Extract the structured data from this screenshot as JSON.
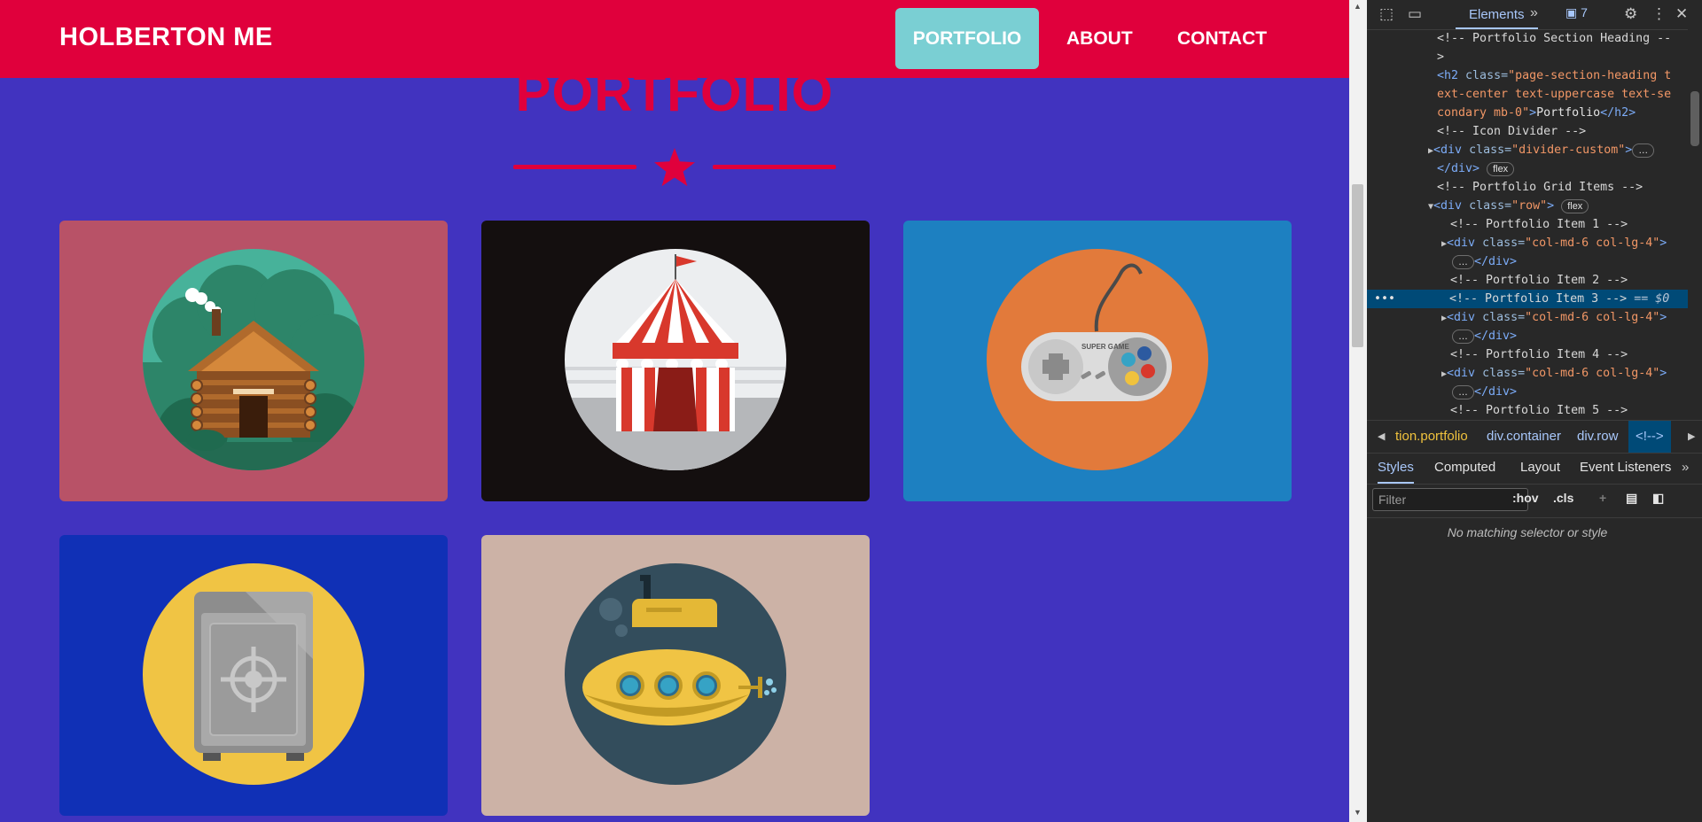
{
  "navbar": {
    "brand": "HOLBERTON ME",
    "links": [
      {
        "label": "PORTFOLIO",
        "active": true
      },
      {
        "label": "ABOUT",
        "active": false
      },
      {
        "label": "CONTACT",
        "active": false
      }
    ]
  },
  "portfolio": {
    "heading": "PORTFOLIO",
    "items": [
      {
        "icon": "log-cabin-icon",
        "bg": "#b85267"
      },
      {
        "icon": "circus-tent-icon",
        "bg": "#140f0f"
      },
      {
        "icon": "game-controller-icon",
        "bg": "#1d80c1",
        "controller_text": "SUPER GAME"
      },
      {
        "icon": "safe-icon",
        "bg": "#1030b6"
      },
      {
        "icon": "submarine-icon",
        "bg": "#ccb2a6"
      }
    ]
  },
  "colors": {
    "accent": "#e0003c",
    "page_bg": "#4133bf",
    "active_nav": "#7acfd3"
  },
  "devtools": {
    "toolbar": {
      "tab_elements": "Elements",
      "messages_count": "7"
    },
    "dom": {
      "l1": "<!-- Portfolio Section Heading --",
      "l2": ">",
      "l3_tag": "<h2",
      "l3_attr": "class=",
      "l3_val": "\"page-section-heading t",
      "l4": "ext-center text-uppercase text-se",
      "l5_val": "condary mb-0\"",
      "l5_text": "Portfolio",
      "l5_close": "</h2>",
      "l6": "<!-- Icon Divider -->",
      "l7_tag": "<div",
      "l7_attr": "class=",
      "l7_val": "\"divider-custom\"",
      "l8": "</div>",
      "pill_flex": "flex",
      "l9": "<!-- Portfolio Grid Items -->",
      "l10_val": "\"row\"",
      "i1": "<!-- Portfolio Item 1 -->",
      "col_val": "\"col-md-6 col-lg-4\"",
      "i2": "<!-- Portfolio Item 2 -->",
      "i3": "<!-- Portfolio Item 3 -->",
      "i3_suffix": "== $0",
      "i4": "<!-- Portfolio Item 4 -->",
      "i5": "<!-- Portfolio Item 5 -->",
      "close_div": "</div>"
    },
    "breadcrumbs": [
      "tion.portfolio",
      "div.container",
      "div.row",
      "<!-->"
    ],
    "panel_tabs": [
      "Styles",
      "Computed",
      "Layout",
      "Event Listeners"
    ],
    "filter_placeholder": "Filter",
    "hov": ":hov",
    "cls": ".cls",
    "no_match": "No matching selector or style"
  }
}
